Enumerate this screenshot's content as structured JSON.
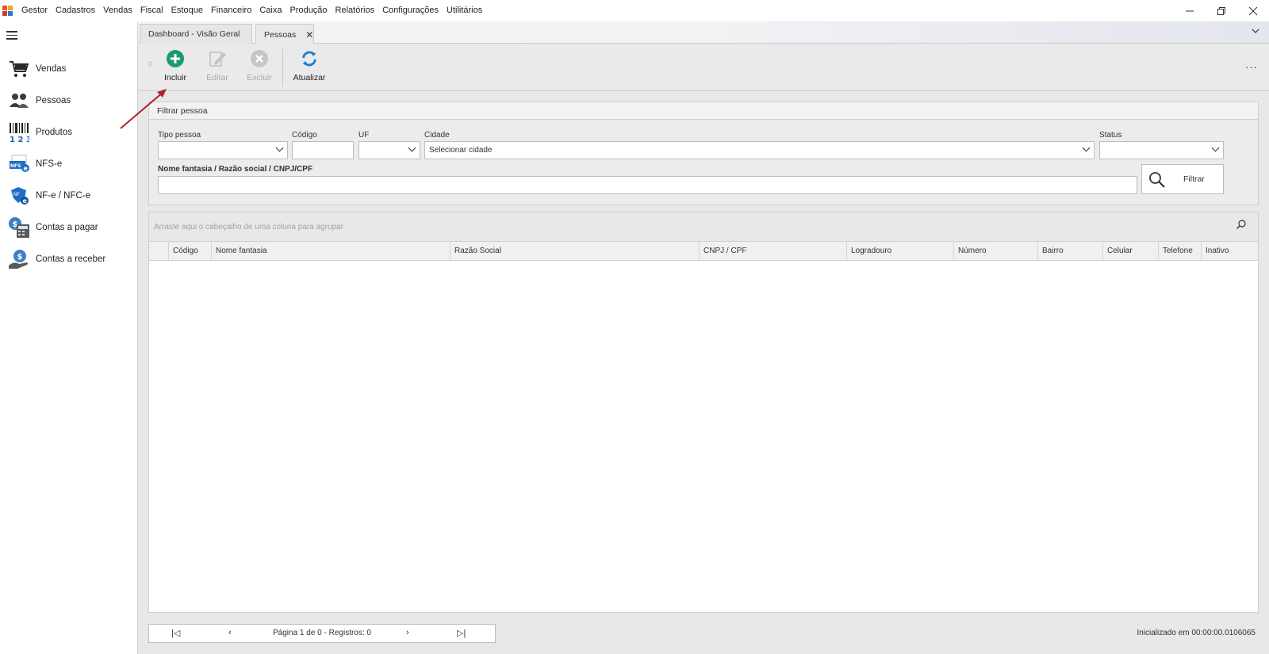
{
  "menubar": {
    "items": [
      "Gestor",
      "Cadastros",
      "Vendas",
      "Fiscal",
      "Estoque",
      "Financeiro",
      "Caixa",
      "Produção",
      "Relatórios",
      "Configurações",
      "Utilitários"
    ],
    "window_controls": {
      "minimize": "—",
      "restore": "❐",
      "close": "✕"
    }
  },
  "sidebar": {
    "items": [
      {
        "label": "Vendas",
        "icon": "cart-icon"
      },
      {
        "label": "Pessoas",
        "icon": "people-icon"
      },
      {
        "label": "Produtos",
        "icon": "barcode-icon"
      },
      {
        "label": "NFS-e",
        "icon": "nfse-icon"
      },
      {
        "label": "NF-e / NFC-e",
        "icon": "nfe-icon"
      },
      {
        "label": "Contas a pagar",
        "icon": "payables-icon"
      },
      {
        "label": "Contas a receber",
        "icon": "receivables-icon"
      }
    ]
  },
  "tabs": {
    "dashboard": "Dashboard - Visão Geral",
    "pessoas": "Pessoas",
    "close": "✕",
    "overflow": "⌄"
  },
  "toolbar": {
    "incluir": "Incluir",
    "editar": "Editar",
    "excluir": "Excluir",
    "atualizar": "Atualizar",
    "more": "···"
  },
  "filter": {
    "title": "Filtrar pessoa",
    "tipo_pessoa_label": "Tipo pessoa",
    "codigo_label": "Código",
    "uf_label": "UF",
    "cidade_label": "Cidade",
    "cidade_value": "Selecionar cidade",
    "status_label": "Status",
    "nome_label": "Nome fantasia / Razão social / CNPJ/CPF",
    "filtrar_button": "Filtrar"
  },
  "grid": {
    "group_hint": "Arraste aqui o cabeçalho de uma coluna para agrupar",
    "columns": [
      "Código",
      "Nome fantasia",
      "Razão Social",
      "CNPJ / CPF",
      "Logradouro",
      "Número",
      "Bairro",
      "Celular",
      "Telefone",
      "Inativo"
    ],
    "rows": []
  },
  "pager": {
    "first": "|◁",
    "prev": "‹",
    "next": "›",
    "last": "▷|",
    "text": "Página 1 de 0 - Registros: 0"
  },
  "status": "Inicializado em 00:00:00.0106065",
  "colors": {
    "accent_green": "#1a9b6c",
    "accent_blue": "#1e7fd0",
    "disabled_gray": "#b5b5b5",
    "annotation_red": "#b3202a"
  }
}
